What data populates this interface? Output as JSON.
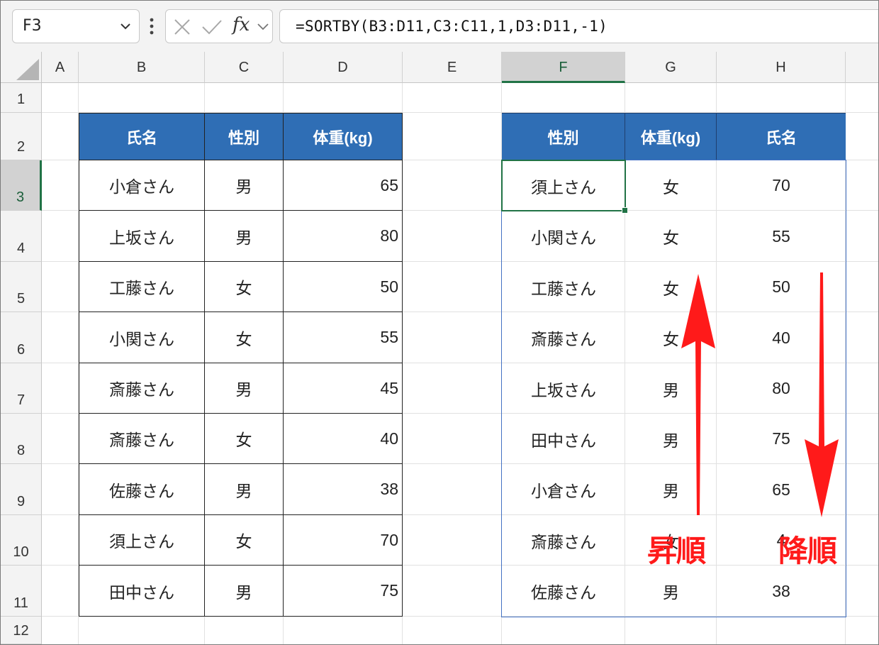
{
  "formula_bar": {
    "name_box": "F3",
    "formula": "=SORTBY(B3:D11,C3:C11,1,D3:D11,-1)",
    "fx_label": "fx"
  },
  "columns": [
    "A",
    "B",
    "C",
    "D",
    "E",
    "F",
    "G",
    "H"
  ],
  "rows": [
    "1",
    "2",
    "3",
    "4",
    "5",
    "6",
    "7",
    "8",
    "9",
    "10",
    "11",
    "12"
  ],
  "source_table": {
    "headers": [
      "氏名",
      "性別",
      "体重(kg)"
    ],
    "rows": [
      [
        "小倉さん",
        "男",
        "65"
      ],
      [
        "上坂さん",
        "男",
        "80"
      ],
      [
        "工藤さん",
        "女",
        "50"
      ],
      [
        "小関さん",
        "女",
        "55"
      ],
      [
        "斎藤さん",
        "男",
        "45"
      ],
      [
        "斎藤さん",
        "女",
        "40"
      ],
      [
        "佐藤さん",
        "男",
        "38"
      ],
      [
        "須上さん",
        "女",
        "70"
      ],
      [
        "田中さん",
        "男",
        "75"
      ]
    ]
  },
  "result_table": {
    "headers": [
      "性別",
      "体重(kg)",
      "氏名"
    ],
    "rows": [
      [
        "須上さん",
        "女",
        "70"
      ],
      [
        "小関さん",
        "女",
        "55"
      ],
      [
        "工藤さん",
        "女",
        "50"
      ],
      [
        "斎藤さん",
        "女",
        "40"
      ],
      [
        "上坂さん",
        "男",
        "80"
      ],
      [
        "田中さん",
        "男",
        "75"
      ],
      [
        "小倉さん",
        "男",
        "65"
      ],
      [
        "斎藤さん",
        "女",
        "4"
      ],
      [
        "佐藤さん",
        "男",
        "38"
      ]
    ]
  },
  "annotations": {
    "ascending": "昇順",
    "descending": "降順",
    "color": "#ff1a1a"
  },
  "colors": {
    "header_fill": "#2f6eb5",
    "selection": "#217346",
    "spill_border": "#4472c4"
  }
}
